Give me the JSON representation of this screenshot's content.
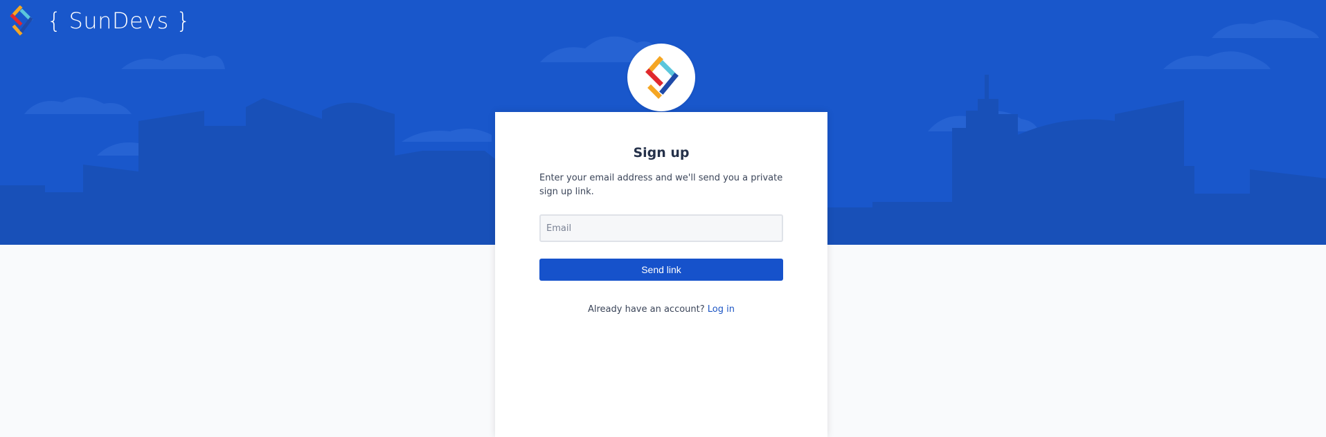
{
  "brand": {
    "name": "{ SunDevs }",
    "logo_icon": "sundevs-logo-icon"
  },
  "colors": {
    "hero_background": "#1957cb",
    "page_background": "#f9fafc",
    "primary_button": "#1652cb",
    "link": "#1d56c4",
    "logo_red": "#e0282e",
    "logo_orange": "#f5a623",
    "logo_cyan": "#5bc6dc",
    "logo_navy": "#1f4aa8"
  },
  "signup": {
    "title": "Sign up",
    "description": "Enter your email address and we'll send you a private sign up link.",
    "email_placeholder": "Email",
    "email_value": "",
    "send_button_label": "Send link",
    "login_prompt": "Already have an account?",
    "login_link_label": "Log in"
  }
}
